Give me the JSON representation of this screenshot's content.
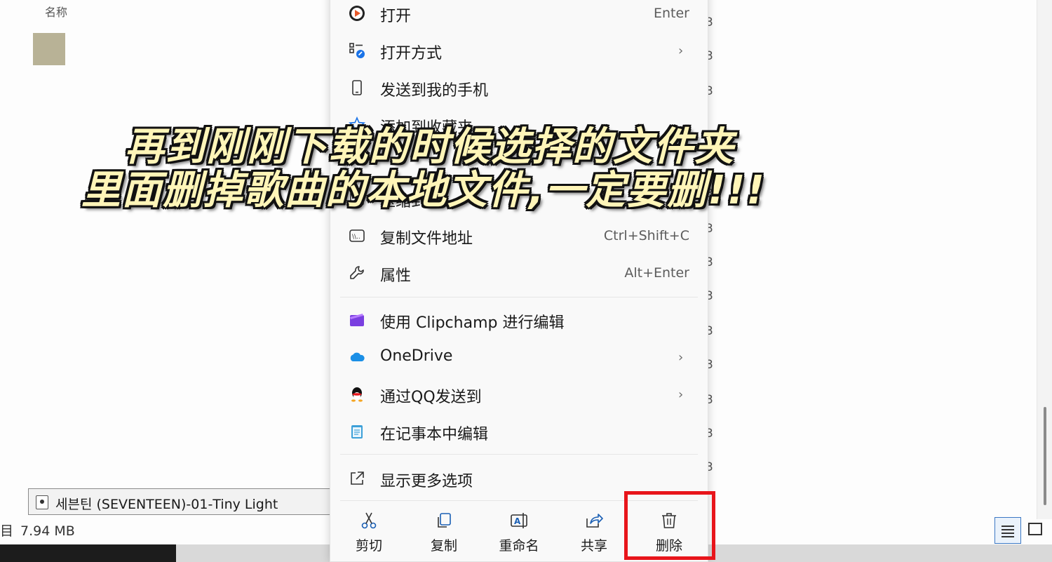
{
  "explorer": {
    "column_header": "名称",
    "right_digits": [
      "3",
      "3",
      "3",
      "3",
      "3",
      "3",
      "3",
      "3",
      "3",
      "3",
      "3",
      "3",
      "3",
      "3"
    ],
    "tooltip_filename": "세븐틴 (SEVENTEEN)-01-Tiny Light",
    "status_left_char": "目",
    "status_size": "7.94 MB"
  },
  "menu": {
    "items": [
      {
        "label": "打开",
        "shortcut": "Enter",
        "icon": "play-icon"
      },
      {
        "label": "打开方式",
        "chevron": "›",
        "icon": "open-with-icon"
      },
      {
        "label": "发送到我的手机",
        "icon": "phone-icon"
      },
      {
        "label": "添加到收藏夹",
        "icon": "star-icon"
      },
      {
        "label": "压缩到...",
        "chevron": "›",
        "icon": "zip-icon"
      },
      {
        "label": "复制文件地址",
        "shortcut": "Ctrl+Shift+C",
        "icon": "copy-path-icon"
      },
      {
        "label": "属性",
        "shortcut": "Alt+Enter",
        "icon": "wrench-icon"
      },
      {
        "label": "使用 Clipchamp 进行编辑",
        "icon": "clipchamp-icon"
      },
      {
        "label": "OneDrive",
        "chevron": "›",
        "icon": "onedrive-icon"
      },
      {
        "label": "通过QQ发送到",
        "chevron": "›",
        "icon": "qq-icon"
      },
      {
        "label": "在记事本中编辑",
        "icon": "notepad-icon"
      },
      {
        "label": "显示更多选项",
        "icon": "more-options-icon"
      }
    ],
    "actions": [
      {
        "label": "剪切",
        "icon": "scissors-icon"
      },
      {
        "label": "复制",
        "icon": "copy-icon"
      },
      {
        "label": "重命名",
        "icon": "rename-icon"
      },
      {
        "label": "共享",
        "icon": "share-icon"
      },
      {
        "label": "删除",
        "icon": "trash-icon"
      }
    ]
  },
  "caption": {
    "line1": "再到刚刚下载的时候选择的文件夹",
    "line2": "里面删掉歌曲的本地文件,一定要删!!!"
  },
  "colors": {
    "highlight": "#e8151b",
    "caption_fill": "#fff5b8",
    "accent": "#3b78c4"
  }
}
